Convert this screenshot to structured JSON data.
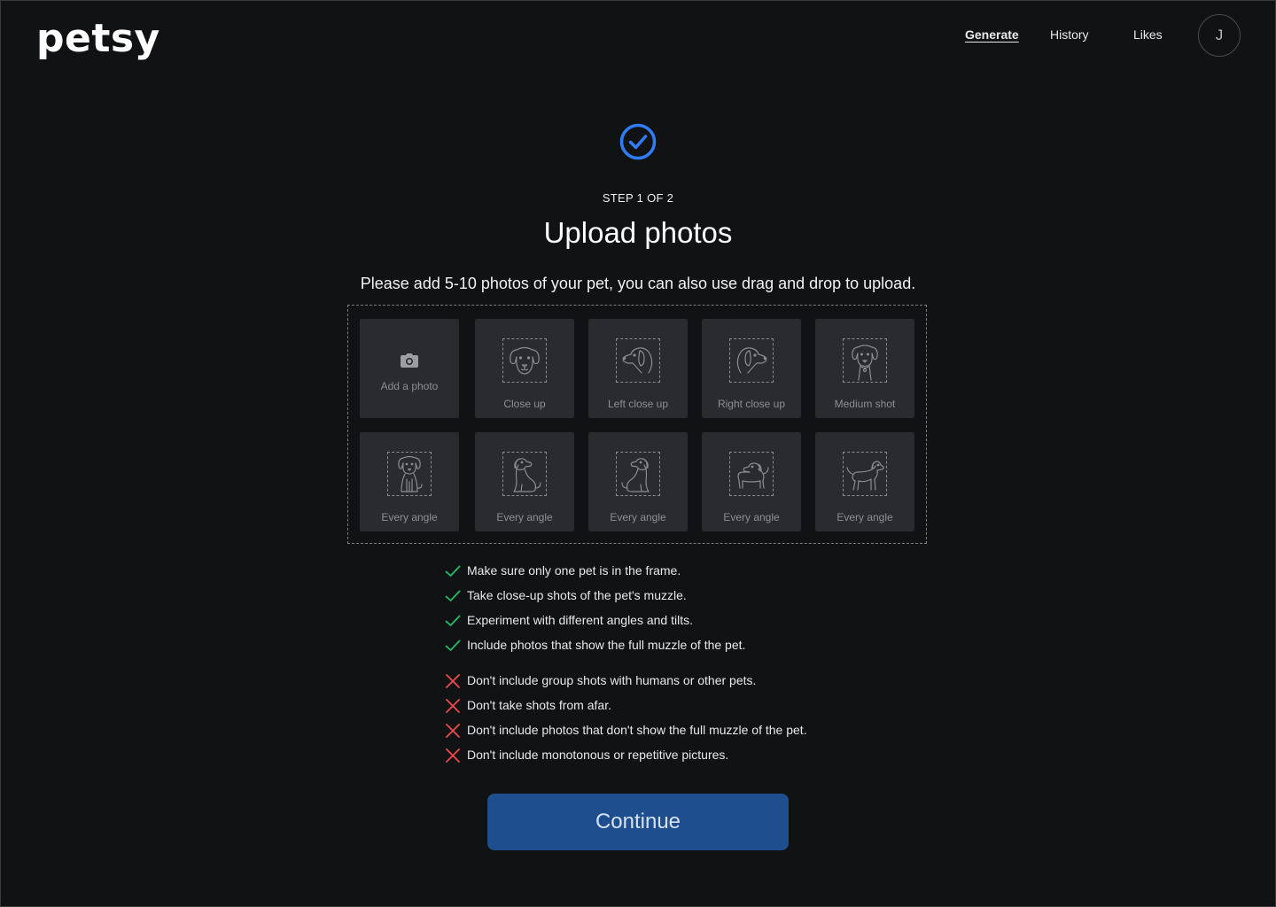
{
  "header": {
    "logo": "petsy",
    "nav": [
      {
        "label": "Generate",
        "active": true
      },
      {
        "label": "History",
        "active": false
      },
      {
        "label": "Likes",
        "active": false
      }
    ],
    "avatar_initial": "J"
  },
  "main": {
    "step": "STEP 1 OF 2",
    "title": "Upload photos",
    "subtitle": "Please add 5-10 photos of your pet, you can also use drag and drop to upload.",
    "tiles": [
      {
        "label": "Add a photo",
        "icon": "camera-icon"
      },
      {
        "label": "Close up",
        "icon": "dog-front-face-icon"
      },
      {
        "label": "Left close up",
        "icon": "dog-left-profile-icon"
      },
      {
        "label": "Right close up",
        "icon": "dog-right-profile-icon"
      },
      {
        "label": "Medium shot",
        "icon": "dog-medium-shot-icon"
      },
      {
        "label": "Every angle",
        "icon": "dog-sitting-front-icon"
      },
      {
        "label": "Every angle",
        "icon": "dog-sitting-side-icon"
      },
      {
        "label": "Every angle",
        "icon": "dog-sitting-turned-icon"
      },
      {
        "label": "Every angle",
        "icon": "dog-standing-icon"
      },
      {
        "label": "Every angle",
        "icon": "dog-standing-side-icon"
      }
    ],
    "dos": [
      "Make sure only one pet is in the frame.",
      "Take close-up shots of the pet's muzzle.",
      "Experiment with different angles and tilts.",
      "Include photos that show the full muzzle of the pet."
    ],
    "donts": [
      "Don't include group shots with humans or other pets.",
      "Don't take shots from afar.",
      "Don't include photos that don't show the full muzzle of the pet.",
      "Don't include monotonous or repetitive pictures."
    ],
    "continue_label": "Continue"
  },
  "colors": {
    "background": "#111214",
    "tile": "#2a2b2f",
    "accent_blue": "#2f7df6",
    "button": "#1f4e8f",
    "check_green": "#1fbf6a",
    "cross_red": "#ef4a4a"
  }
}
